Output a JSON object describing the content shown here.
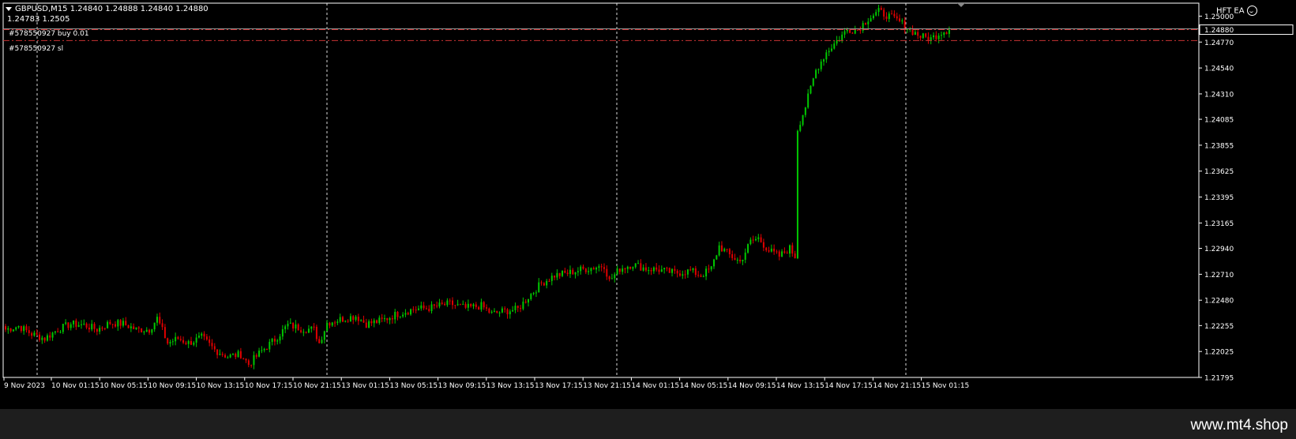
{
  "header": {
    "symbol_line": "GBPUSD,M15  1.24840 1.24888 1.24840 1.24880",
    "sub_line": "1.24783 1.2505",
    "expert": "HFT EA"
  },
  "trade_labels": {
    "buy": "#578550927 buy 0.01",
    "sl": "#578550927 sl"
  },
  "current_price_label": "1.24880",
  "watermark": "www.mt4.shop",
  "colors": {
    "background": "#000000",
    "bull": "#00c800",
    "bear": "#e00000",
    "trade_line": "#c83232",
    "axis_text": "#ffffff",
    "grid": "#ffffff"
  },
  "chart_data": {
    "type": "candlestick",
    "timeframe": "M15",
    "symbol": "GBPUSD",
    "ylim": [
      1.21795,
      1.25115
    ],
    "y_ticks": [
      "1.25000",
      "1.24770",
      "1.24540",
      "1.24310",
      "1.24085",
      "1.23855",
      "1.23625",
      "1.23395",
      "1.23165",
      "1.22940",
      "1.22710",
      "1.22480",
      "1.22255",
      "1.22025",
      "1.21795"
    ],
    "x_ticks": [
      "9 Nov 2023",
      "10 Nov 01:15",
      "10 Nov 05:15",
      "10 Nov 09:15",
      "10 Nov 13:15",
      "10 Nov 17:15",
      "10 Nov 21:15",
      "13 Nov 01:15",
      "13 Nov 05:15",
      "13 Nov 09:15",
      "13 Nov 13:15",
      "13 Nov 17:15",
      "13 Nov 21:15",
      "14 Nov 01:15",
      "14 Nov 05:15",
      "14 Nov 09:15",
      "14 Nov 13:15",
      "14 Nov 17:15",
      "14 Nov 21:15",
      "15 Nov 01:15"
    ],
    "trade_lines": [
      {
        "label": "buy",
        "price": 1.2488
      },
      {
        "label": "sl",
        "price": 1.24783
      }
    ],
    "close_anchors": [
      [
        0,
        1.2222
      ],
      [
        5,
        1.2225
      ],
      [
        10,
        1.2218
      ],
      [
        15,
        1.2214
      ],
      [
        20,
        1.2222
      ],
      [
        25,
        1.2227
      ],
      [
        30,
        1.2226
      ],
      [
        35,
        1.2222
      ],
      [
        40,
        1.2228
      ],
      [
        45,
        1.2227
      ],
      [
        50,
        1.2222
      ],
      [
        55,
        1.2222
      ],
      [
        58,
        1.2232
      ],
      [
        62,
        1.221
      ],
      [
        66,
        1.2214
      ],
      [
        70,
        1.221
      ],
      [
        75,
        1.2215
      ],
      [
        80,
        1.2204
      ],
      [
        85,
        1.2198
      ],
      [
        90,
        1.22
      ],
      [
        93,
        1.2191
      ],
      [
        98,
        1.2203
      ],
      [
        103,
        1.2213
      ],
      [
        108,
        1.2226
      ],
      [
        113,
        1.2223
      ],
      [
        118,
        1.2222
      ],
      [
        120,
        1.221
      ],
      [
        123,
        1.2228
      ],
      [
        128,
        1.2231
      ],
      [
        134,
        1.2234
      ],
      [
        138,
        1.2227
      ],
      [
        144,
        1.223
      ],
      [
        150,
        1.2236
      ],
      [
        156,
        1.224
      ],
      [
        162,
        1.2241
      ],
      [
        166,
        1.2243
      ],
      [
        170,
        1.2245
      ],
      [
        176,
        1.2241
      ],
      [
        182,
        1.2243
      ],
      [
        186,
        1.2236
      ],
      [
        190,
        1.2238
      ],
      [
        196,
        1.224
      ],
      [
        200,
        1.2251
      ],
      [
        205,
        1.2263
      ],
      [
        210,
        1.227
      ],
      [
        215,
        1.2272
      ],
      [
        220,
        1.2275
      ],
      [
        225,
        1.2277
      ],
      [
        229,
        1.2279
      ],
      [
        231,
        1.2265
      ],
      [
        235,
        1.2276
      ],
      [
        240,
        1.228
      ],
      [
        245,
        1.2276
      ],
      [
        250,
        1.2275
      ],
      [
        256,
        1.2272
      ],
      [
        262,
        1.2274
      ],
      [
        266,
        1.227
      ],
      [
        270,
        1.2276
      ],
      [
        273,
        1.2296
      ],
      [
        277,
        1.2288
      ],
      [
        281,
        1.2282
      ],
      [
        285,
        1.23
      ],
      [
        288,
        1.2303
      ],
      [
        292,
        1.2292
      ],
      [
        296,
        1.2287
      ],
      [
        300,
        1.2294
      ],
      [
        302,
        1.2287
      ],
      [
        303,
        1.24
      ],
      [
        306,
        1.242
      ],
      [
        310,
        1.2452
      ],
      [
        314,
        1.2468
      ],
      [
        318,
        1.2478
      ],
      [
        322,
        1.2488
      ],
      [
        326,
        1.2488
      ],
      [
        330,
        1.2498
      ],
      [
        334,
        1.2504
      ],
      [
        337,
        1.2501
      ],
      [
        342,
        1.2495
      ],
      [
        346,
        1.2488
      ],
      [
        350,
        1.2482
      ],
      [
        354,
        1.248
      ],
      [
        358,
        1.2486
      ],
      [
        361,
        1.2488
      ]
    ]
  }
}
